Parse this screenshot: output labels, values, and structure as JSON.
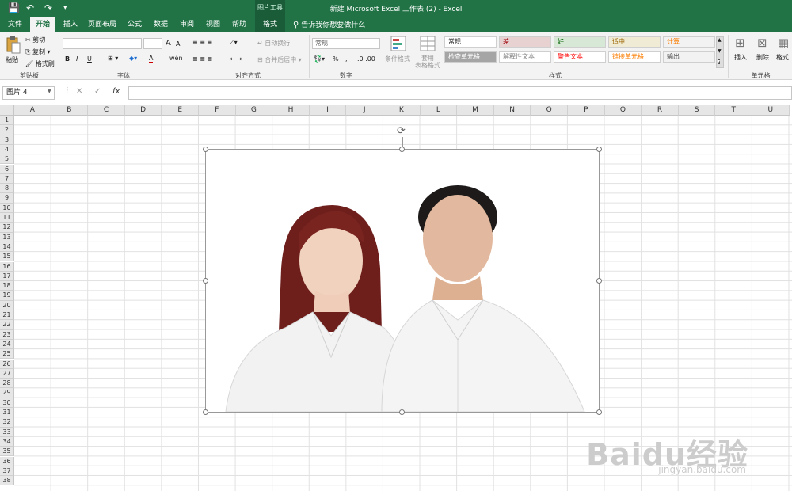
{
  "title_bar": {
    "title": "新建 Microsoft Excel 工作表 (2)  -  Excel",
    "context_tool": "图片工具",
    "quick_access": {
      "save": "💾",
      "undo": "↶",
      "redo": "↷",
      "more": "▾"
    }
  },
  "tabs": [
    "文件",
    "开始",
    "插入",
    "页面布局",
    "公式",
    "数据",
    "审阅",
    "视图",
    "帮助",
    "格式"
  ],
  "search_placeholder": "告诉我你想要做什么",
  "ribbon": {
    "clipboard": {
      "paste": "粘贴",
      "cut": "剪切",
      "copy": "复制",
      "format_painter": "格式刷",
      "label": "剪贴板"
    },
    "font": {
      "label": "字体",
      "bold": "B",
      "italic": "I",
      "underline": "U",
      "grow": "A",
      "shrink": "A",
      "font_color": "A",
      "fill_label": "wén"
    },
    "alignment": {
      "label": "对齐方式",
      "wrap": "自动换行",
      "merge": "合并后居中"
    },
    "number": {
      "label": "数字",
      "format": "常规",
      "percent": "%",
      "comma": ","
    },
    "styles": {
      "label": "样式",
      "conditional": "条件格式",
      "table": "套用\n表格格式",
      "cells": [
        {
          "text": "常规",
          "bg": "#ffffff",
          "color": "#222222"
        },
        {
          "text": "差",
          "bg": "#e7d1d1",
          "color": "#9c0006"
        },
        {
          "text": "好",
          "bg": "#d7e8d7",
          "color": "#006100"
        },
        {
          "text": "适中",
          "bg": "#f0ebd4",
          "color": "#9c6500"
        },
        {
          "text": "计算",
          "bg": "#f2f2f2",
          "color": "#fa7d00"
        },
        {
          "text": "检查单元格",
          "bg": "#a5a5a5",
          "color": "#ffffff"
        },
        {
          "text": "解释性文本",
          "bg": "#ffffff",
          "color": "#7f7f7f"
        },
        {
          "text": "警告文本",
          "bg": "#ffffff",
          "color": "#ff0000"
        },
        {
          "text": "链接单元格",
          "bg": "#ffffff",
          "color": "#fa7d00"
        },
        {
          "text": "输出",
          "bg": "#f2f2f2",
          "color": "#3f3f3f"
        }
      ]
    },
    "cells": {
      "label": "单元格",
      "insert": "插入",
      "delete": "删除",
      "format": "格式"
    }
  },
  "formula_bar": {
    "name_box": "图片 4",
    "cancel": "✕",
    "enter": "✓",
    "fx": "fx",
    "value": ""
  },
  "columns": [
    "A",
    "B",
    "C",
    "D",
    "E",
    "F",
    "G",
    "H",
    "I",
    "J",
    "K",
    "L",
    "M",
    "N",
    "O",
    "P",
    "Q",
    "R",
    "S",
    "T",
    "U"
  ],
  "rows": [
    "1",
    "2",
    "3",
    "4",
    "5",
    "6",
    "7",
    "8",
    "9",
    "10",
    "11",
    "12",
    "13",
    "14",
    "15",
    "16",
    "17",
    "18",
    "19",
    "20",
    "21",
    "22",
    "23",
    "24",
    "25",
    "26",
    "27",
    "28",
    "29",
    "30",
    "31",
    "32",
    "33",
    "34",
    "35",
    "36",
    "37",
    "38"
  ],
  "selected_object": "图片 4",
  "watermark": {
    "main": "Baidu经验",
    "sub": "jingyan.baidu.com"
  },
  "colors": {
    "accent": "#217346",
    "accent_dark": "#1a5c38"
  }
}
